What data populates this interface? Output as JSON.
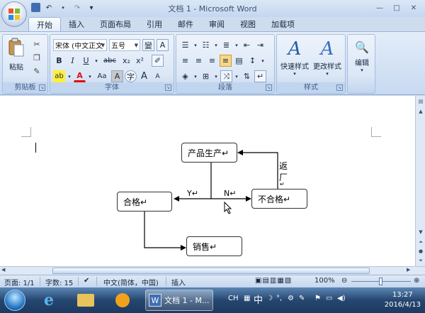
{
  "window": {
    "title": "文档 1 - Microsoft Word",
    "minimize": "—",
    "maximize": "□",
    "close": "✕"
  },
  "qat": {
    "save": "💾",
    "undo": "↶",
    "redo": "↷",
    "customize": "▾"
  },
  "tabs": [
    {
      "label": "开始",
      "active": true
    },
    {
      "label": "插入"
    },
    {
      "label": "页面布局"
    },
    {
      "label": "引用"
    },
    {
      "label": "邮件"
    },
    {
      "label": "审阅"
    },
    {
      "label": "视图"
    },
    {
      "label": "加载项"
    }
  ],
  "ribbon": {
    "clipboard": {
      "label": "剪贴板",
      "paste_label": "粘贴"
    },
    "font": {
      "label": "字体",
      "font_name": "宋体 (中文正文",
      "font_size": "五号",
      "bold": "B",
      "italic": "I",
      "underline": "U",
      "strike": "abc",
      "subscript": "x₂",
      "superscript": "x²",
      "grow": "A",
      "shrink": "A",
      "wen": "變",
      "case": "Aa",
      "highlight": "ab",
      "color": "A",
      "char_shade": "A",
      "enclose": "字",
      "phonetic": "A"
    },
    "paragraph": {
      "label": "段落"
    },
    "styles": {
      "label": "样式",
      "quick_styles": "快速样式",
      "change_styles": "更改样式"
    },
    "editing": {
      "label": "编辑"
    }
  },
  "diagram": {
    "produce": "产品生产↵",
    "pass": "合格↵",
    "fail": "不合格↵",
    "sales": "销售↵",
    "yes_label": "Y↵",
    "no_label": "N↵",
    "return_label": [
      "返",
      "厂",
      "↵"
    ]
  },
  "statusbar": {
    "page": "页面: 1/1",
    "words": "字数: 15",
    "language": "中文(简体，中国)",
    "insert_mode": "插入",
    "zoom": "100%"
  },
  "taskbar": {
    "task_title": "文档 1 - M...",
    "lang": "CH",
    "ime": "中",
    "time": "13:27",
    "date": "2016/4/13"
  }
}
